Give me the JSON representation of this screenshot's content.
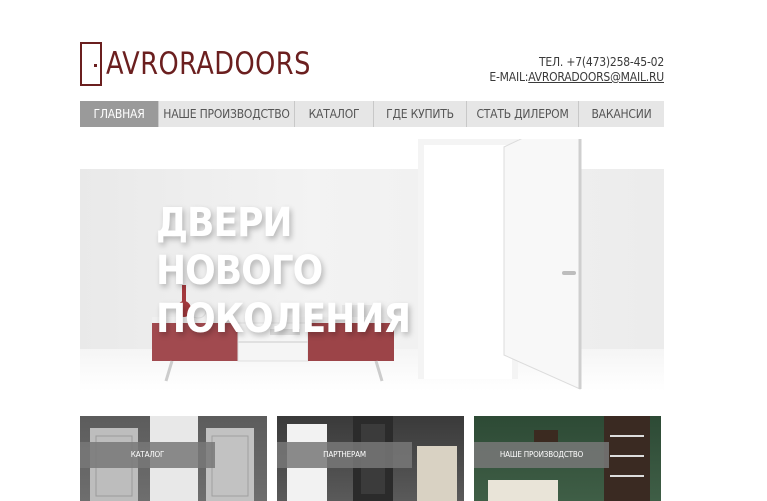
{
  "header": {
    "logo_text": "AVRORADOORS",
    "phone": "ТЕЛ. +7(473)258-45-02",
    "email_prefix": "E-MAIL:",
    "email": "AVRORADOORS@MAIL.RU"
  },
  "nav": {
    "items": [
      "ГЛАВНАЯ",
      "НАШЕ ПРОИЗВОДСТВО",
      "КАТАЛОГ",
      "ГДЕ КУПИТЬ",
      "СТАТЬ ДИЛЕРОМ",
      "ВАКАНСИИ"
    ],
    "active_index": 0
  },
  "hero": {
    "title_line1": "ДВЕРИ НОВОГО",
    "title_line2": "ПОКОЛЕНИЯ"
  },
  "tiles": [
    {
      "label": "КАТАЛОГ"
    },
    {
      "label": "ПАРТНЕРАМ"
    },
    {
      "label": "НАШЕ ПРОИЗВОДСТВО"
    }
  ],
  "colors": {
    "brand": "#6b1f1f",
    "nav_bg": "#e6e6e6",
    "nav_active": "#9a9a9a",
    "tile_label_bg": "#787878"
  }
}
